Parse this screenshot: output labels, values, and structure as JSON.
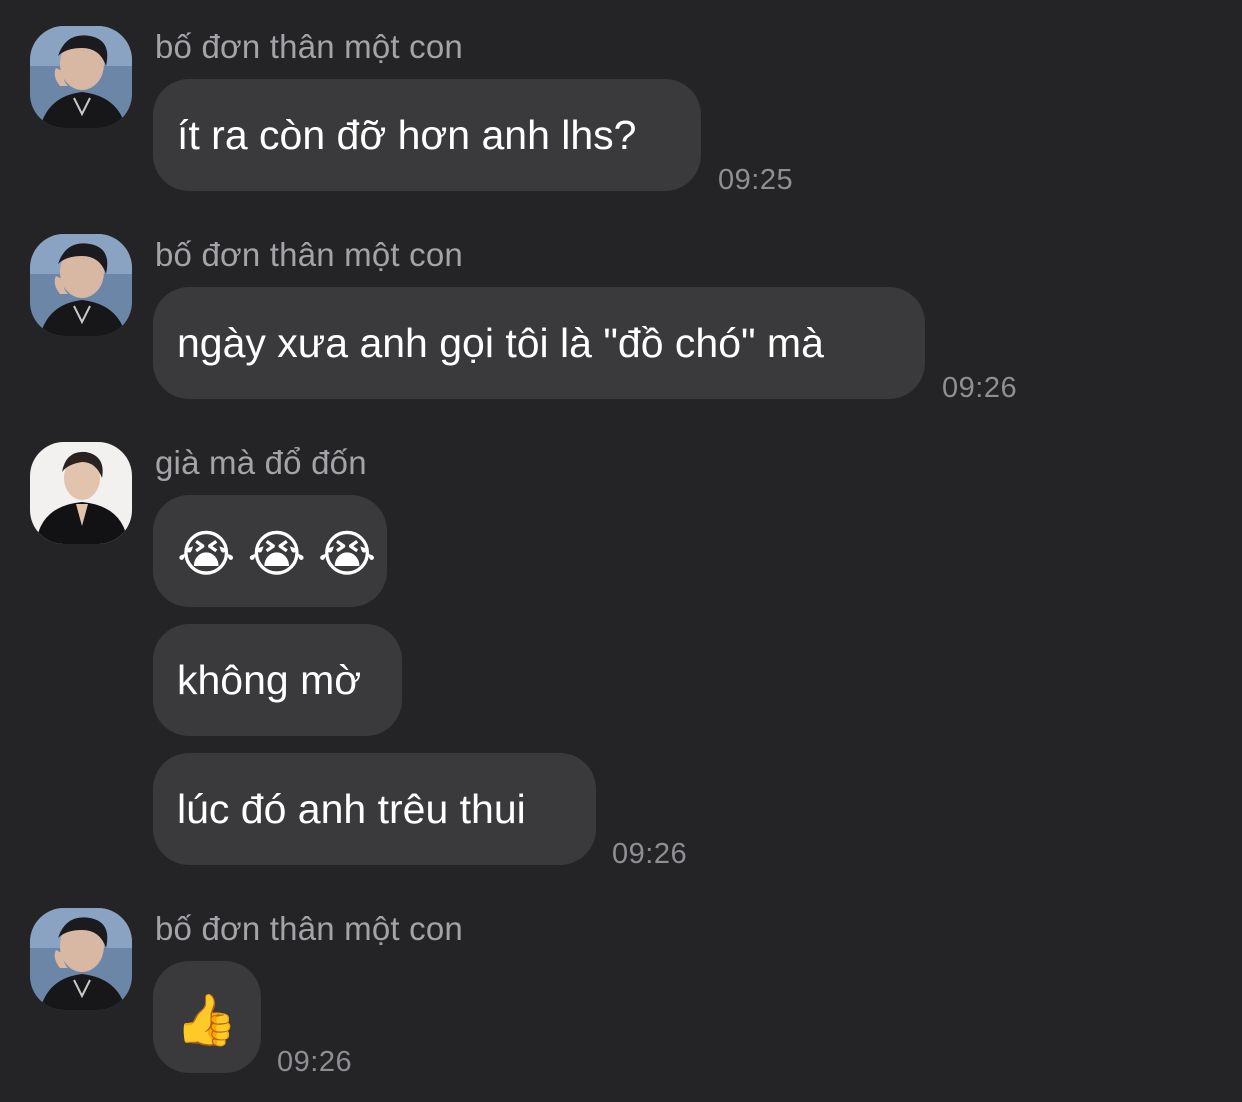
{
  "messages": [
    {
      "sender": "bố đơn thân một con",
      "text": "ít ra còn đỡ hơn anh lhs?",
      "time": "09:25"
    },
    {
      "sender": "bố đơn thân một con",
      "text": "ngày xưa anh gọi tôi là \"đồ chó\" mà",
      "time": "09:26"
    },
    {
      "sender": "già mà đổ đốn",
      "emojis": [
        "😭",
        "😭",
        "😭"
      ],
      "text_2": "không mờ",
      "text_3": "lúc đó anh trêu thui",
      "time": "09:26"
    },
    {
      "sender": "bố đơn thân một con",
      "emoji": "👍",
      "time": "09:26"
    }
  ],
  "icons": {
    "avatar_1": "avatar-man-black-shirt-icon",
    "avatar_2": "avatar-man-black-jacket-icon",
    "emoji_cry": "loudly-crying-face-emoji",
    "emoji_thumbs": "thumbs-up-emoji"
  },
  "colors": {
    "background": "#242426",
    "bubble": "#3a3a3c",
    "sender_text": "#a3a3a8",
    "timestamp": "#8e8e93",
    "message_text": "#ffffff"
  }
}
